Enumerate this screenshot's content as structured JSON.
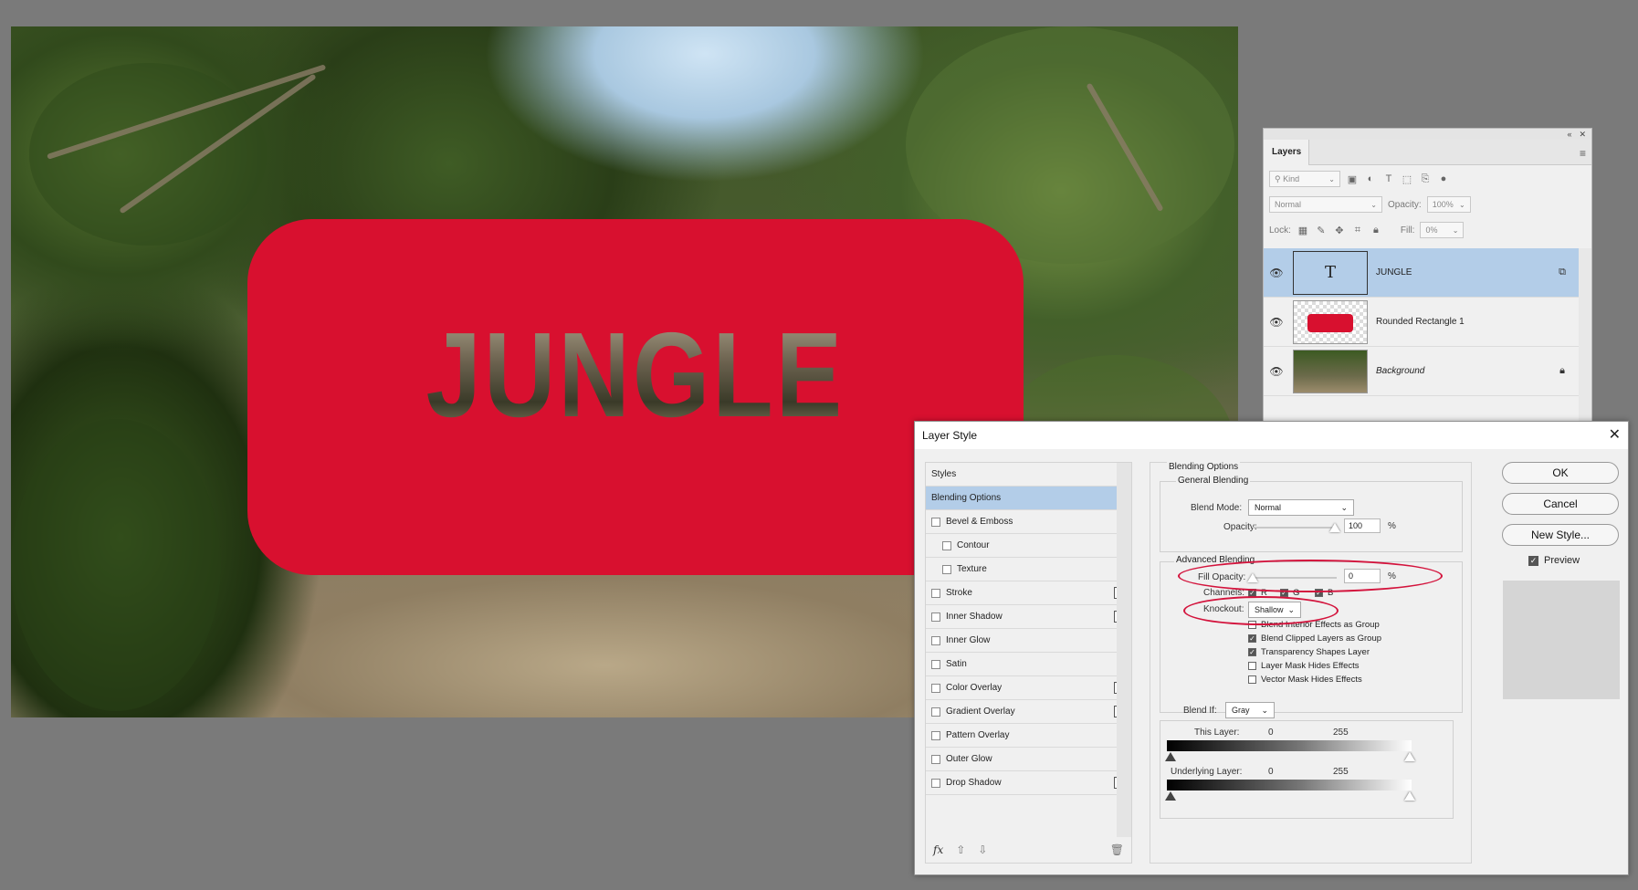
{
  "canvas": {
    "banner_text": "JUNGLE",
    "banner_color": "#d8102f"
  },
  "layers_panel": {
    "tab": "Layers",
    "filter": "Kind",
    "blend_mode": "Normal",
    "opacity_label": "Opacity:",
    "opacity_value": "100%",
    "lock_label": "Lock:",
    "fill_label": "Fill:",
    "fill_value": "0%",
    "layers": [
      {
        "name": "JUNGLE",
        "kind": "text",
        "thumb": "T",
        "selected": true
      },
      {
        "name": "Rounded Rectangle 1",
        "kind": "shape",
        "selected": false
      },
      {
        "name": "Background",
        "kind": "image",
        "selected": false,
        "locked": true
      }
    ]
  },
  "dialog": {
    "title": "Layer Style",
    "styles_header": "Styles",
    "items": [
      {
        "label": "Blending Options",
        "selected": true
      },
      {
        "label": "Bevel & Emboss",
        "checkbox": true
      },
      {
        "label": "Contour",
        "checkbox": true,
        "sub": true
      },
      {
        "label": "Texture",
        "checkbox": true,
        "sub": true
      },
      {
        "label": "Stroke",
        "checkbox": true,
        "plus": true
      },
      {
        "label": "Inner Shadow",
        "checkbox": true,
        "plus": true
      },
      {
        "label": "Inner Glow",
        "checkbox": true
      },
      {
        "label": "Satin",
        "checkbox": true
      },
      {
        "label": "Color Overlay",
        "checkbox": true,
        "plus": true
      },
      {
        "label": "Gradient Overlay",
        "checkbox": true,
        "plus": true
      },
      {
        "label": "Pattern Overlay",
        "checkbox": true
      },
      {
        "label": "Outer Glow",
        "checkbox": true
      },
      {
        "label": "Drop Shadow",
        "checkbox": true,
        "plus": true
      }
    ],
    "fx_label": "fx",
    "blending": {
      "section": "Blending Options",
      "general": "General Blending",
      "blend_mode_label": "Blend Mode:",
      "blend_mode": "Normal",
      "opacity_label": "Opacity:",
      "opacity": "100",
      "pct": "%",
      "advanced": "Advanced Blending",
      "fill_opacity_label": "Fill Opacity:",
      "fill_opacity": "0",
      "channels_label": "Channels:",
      "channel_r": "R",
      "channel_g": "G",
      "channel_b": "B",
      "knockout_label": "Knockout:",
      "knockout": "Shallow",
      "opts": [
        {
          "label": "Blend Interior Effects as Group",
          "checked": false
        },
        {
          "label": "Blend Clipped Layers as Group",
          "checked": true
        },
        {
          "label": "Transparency Shapes Layer",
          "checked": true
        },
        {
          "label": "Layer Mask Hides Effects",
          "checked": false
        },
        {
          "label": "Vector Mask Hides Effects",
          "checked": false
        }
      ],
      "blend_if_label": "Blend If:",
      "blend_if": "Gray",
      "this_layer_label": "This Layer:",
      "underlying_label": "Underlying Layer:",
      "range_min": "0",
      "range_max": "255"
    },
    "buttons": {
      "ok": "OK",
      "cancel": "Cancel",
      "new_style": "New Style...",
      "preview": "Preview"
    },
    "highlight_color": "#d3133c"
  }
}
